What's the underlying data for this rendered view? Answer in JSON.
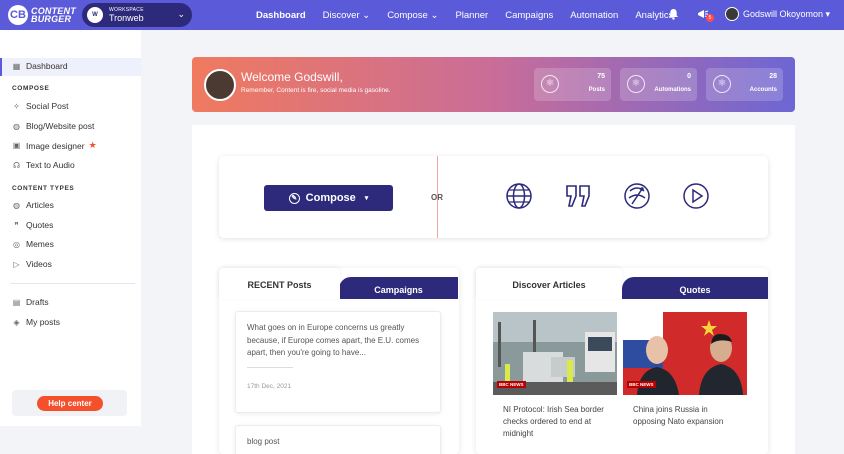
{
  "app": {
    "logo_mark": "CB",
    "logo_line1": "CONTENT",
    "logo_line2": "BURGER",
    "workspace_label": "WORKSPACE",
    "workspace_name": "Tronweb",
    "workspace_avatar_text": "W",
    "caret": "⌄"
  },
  "nav": {
    "items": [
      "Dashboard",
      "Discover ⌄",
      "Compose ⌄",
      "Planner",
      "Campaigns",
      "Automation",
      "Analytics"
    ],
    "notification_count": "5",
    "user_name": "Godswill Okoyomon ▾"
  },
  "sidebar": {
    "dashboard": "Dashboard",
    "compose_heading": "COMPOSE",
    "compose_items": [
      "Social Post",
      "Blog/Website post",
      "Image designer",
      "Text to Audio"
    ],
    "content_types_heading": "CONTENT TYPES",
    "content_items": [
      "Articles",
      "Quotes",
      "Memes",
      "Videos"
    ],
    "other_items": [
      "Drafts",
      "My posts"
    ],
    "help_button": "Help center",
    "new_star": "★"
  },
  "banner": {
    "title": "Welcome Godswill,",
    "subtitle": "Remember, Content is fire, social media is gasoline.",
    "stats": [
      {
        "value": "75",
        "label": "Posts"
      },
      {
        "value": "0",
        "label": "Automations"
      },
      {
        "value": "28",
        "label": "Accounts"
      }
    ]
  },
  "compose": {
    "button_label": "Compose",
    "caret": "▾",
    "or_text": "OR"
  },
  "recent": {
    "tab_left": "RECENT Posts",
    "tab_right": "Campaigns",
    "posts": [
      {
        "text": "What goes on in Europe concerns us greatly because, if Europe comes apart, the E.U. comes apart, then you're going to have...",
        "date": "17th Dec, 2021"
      },
      {
        "text": "blog post",
        "date": ""
      }
    ]
  },
  "discover": {
    "tab_left": "Discover Articles",
    "tab_right": "Quotes",
    "bbc_label": "BBC NEWS",
    "articles": [
      {
        "title": "NI Protocol: Irish Sea border checks ordered to end at midnight"
      },
      {
        "title": "China joins Russia in opposing Nato expansion"
      }
    ]
  },
  "colors": {
    "primary": "#5b5bd9",
    "dark": "#2d2a7c",
    "help": "#f4502c"
  }
}
